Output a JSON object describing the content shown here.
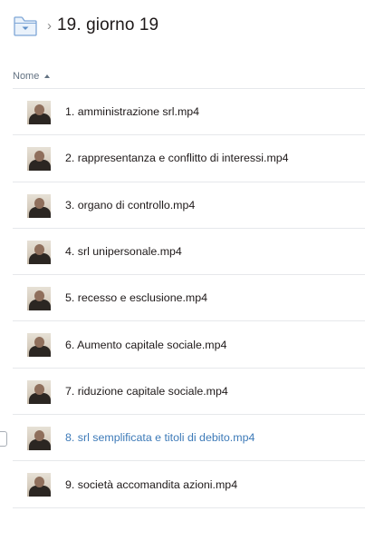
{
  "breadcrumb": {
    "separator": "›",
    "title": "19. giorno 19"
  },
  "table": {
    "column_name": "Nome",
    "sort": "ascending"
  },
  "files": [
    {
      "name": "1. amministrazione srl.mp4"
    },
    {
      "name": "2. rappresentanza e conflitto di interessi.mp4"
    },
    {
      "name": "3. organo di controllo.mp4"
    },
    {
      "name": "4. srl unipersonale.mp4"
    },
    {
      "name": "5. recesso e esclusione.mp4"
    },
    {
      "name": "6. Aumento capitale sociale.mp4"
    },
    {
      "name": "7. riduzione capitale sociale.mp4"
    },
    {
      "name": "8. srl semplificata e titoli di debito.mp4",
      "hovered": true
    },
    {
      "name": "9. società accomandita azioni.mp4"
    }
  ],
  "colors": {
    "text": "#1e1919",
    "link_hover": "#3d7ab8",
    "folder_blue": "#7ea6d6",
    "divider": "#e6e8eb",
    "header_text": "#637282"
  },
  "icons": {
    "folder": "folder-icon",
    "sort": "sort-ascending-icon",
    "thumbnail": "video-thumbnail"
  }
}
